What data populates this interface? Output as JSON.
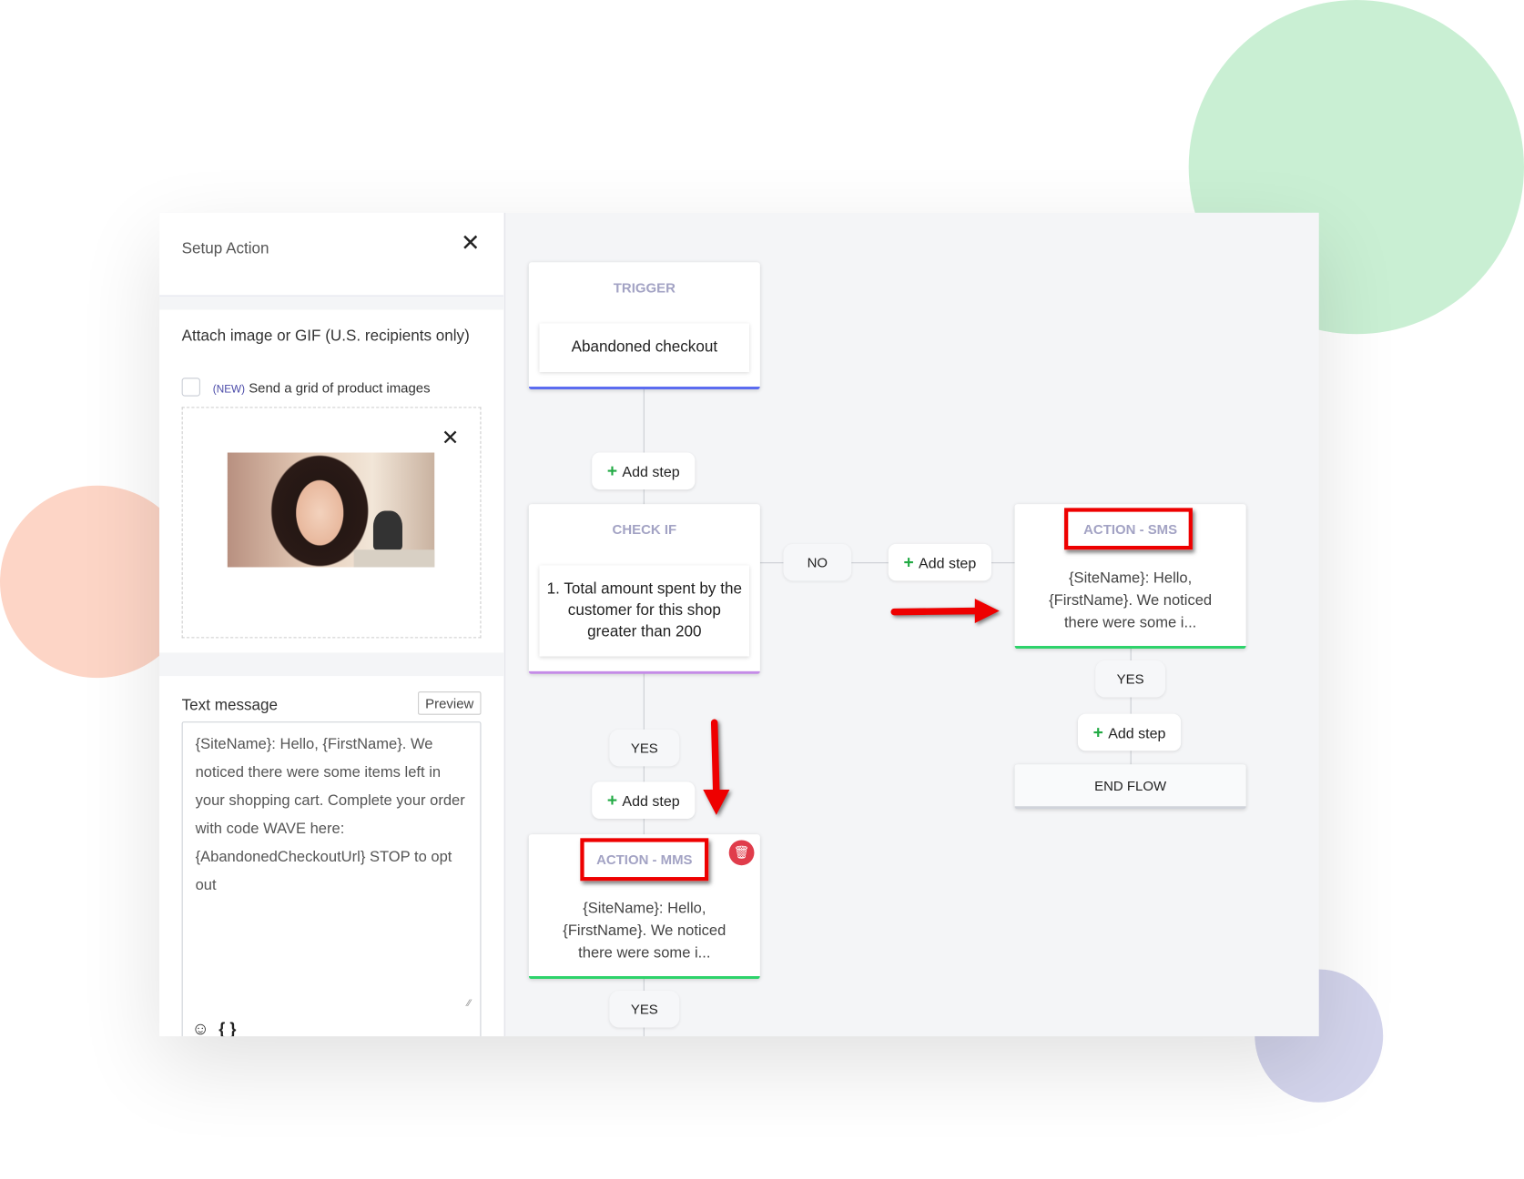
{
  "colors": {
    "accent_trigger": "#5b6cf0",
    "accent_check": "#c58be8",
    "accent_action": "#2ed36b",
    "annotation": "#e00000",
    "delete": "#e03c4b",
    "plus": "#22aa44"
  },
  "panel": {
    "title": "Setup Action",
    "close_icon": "close-icon",
    "attach": {
      "label": "Attach image or GIF (U.S. recipients only)",
      "new_badge": "(NEW)",
      "grid_option_label": "Send a grid of product images",
      "grid_checked": false
    },
    "text_message": {
      "label": "Text message",
      "preview_label": "Preview",
      "value": "{SiteName}: Hello, {FirstName}. We noticed there were some items left in your shopping cart. Complete your order with code WAVE here: {AbandonedCheckoutUrl} STOP to opt out",
      "emoji_icon": "smiley-icon",
      "variable_icon": "{ }"
    }
  },
  "flow": {
    "trigger": {
      "title": "TRIGGER",
      "value": "Abandoned checkout"
    },
    "add_step_label": "Add step",
    "check": {
      "title": "CHECK IF",
      "condition": "1. Total amount spent by the customer for this shop greater than 200"
    },
    "no_label": "NO",
    "yes_label": "YES",
    "sms": {
      "title": "ACTION - SMS",
      "preview": "{SiteName}: Hello, {FirstName}. We noticed there were some i..."
    },
    "mms": {
      "title": "ACTION - MMS",
      "preview": "{SiteName}: Hello, {FirstName}. We noticed there were some i..."
    },
    "end_flow": "END FLOW"
  }
}
